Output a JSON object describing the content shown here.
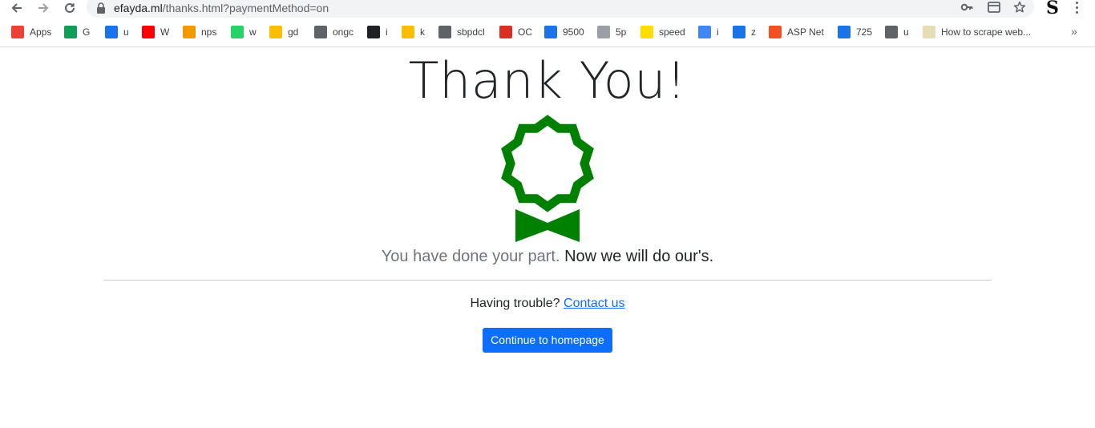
{
  "browser": {
    "url_host": "efayda.ml",
    "url_path": "/thanks.html?paymentMethod=on",
    "profile_letter": "S",
    "bookmarks": [
      {
        "label": "Apps",
        "icon": "apps-grid-icon",
        "color": "#ea4335"
      },
      {
        "label": "G",
        "icon": "google-sheets-icon",
        "color": "#0f9d58"
      },
      {
        "label": "u",
        "icon": "u-logo-icon",
        "color": "#1a73e8"
      },
      {
        "label": "W",
        "icon": "youtube-icon",
        "color": "#ff0000"
      },
      {
        "label": "nps",
        "icon": "nps-icon",
        "color": "#f29900"
      },
      {
        "label": "w",
        "icon": "whatsapp-icon",
        "color": "#25d366"
      },
      {
        "label": "gd",
        "icon": "google-drive-icon",
        "color": "#fbbc04"
      },
      {
        "label": "ongc",
        "icon": "globe-icon",
        "color": "#5f6368"
      },
      {
        "label": "i",
        "icon": "inv-icon",
        "color": "#202124"
      },
      {
        "label": "k",
        "icon": "google-keep-icon",
        "color": "#fbbc04"
      },
      {
        "label": "sbpdcl",
        "icon": "globe-icon",
        "color": "#5f6368"
      },
      {
        "label": "OC",
        "icon": "oc-icon",
        "color": "#d93025"
      },
      {
        "label": "9500",
        "icon": "chart-icon",
        "color": "#1a73e8"
      },
      {
        "label": "5p",
        "icon": "photo-icon",
        "color": "#9aa0a6"
      },
      {
        "label": "speed",
        "icon": "p-logo-icon",
        "color": "#ffdd00"
      },
      {
        "label": "i",
        "icon": "infinity-icon",
        "color": "#4285f4"
      },
      {
        "label": "z",
        "icon": "mail-open-icon",
        "color": "#1a73e8"
      },
      {
        "label": "ASP Net",
        "icon": "microsoft-icon",
        "color": "#f25022"
      },
      {
        "label": "725",
        "icon": "u-logo-icon",
        "color": "#1a73e8"
      },
      {
        "label": "u",
        "icon": "globe-icon",
        "color": "#5f6368"
      },
      {
        "label": "How to scrape web...",
        "icon": "g-logo-icon",
        "color": "#e8dcb5"
      }
    ],
    "more_label": "»"
  },
  "page": {
    "title": "Thank You!",
    "lead_light": "You have done your part.",
    "lead_strong": "Now we will do our's.",
    "trouble_text": "Having trouble?",
    "contact_link": "Contact us",
    "continue_button": "Continue to homepage"
  },
  "colors": {
    "badge": "#008000",
    "button": "#0d6efd",
    "link": "#0d6efd"
  }
}
